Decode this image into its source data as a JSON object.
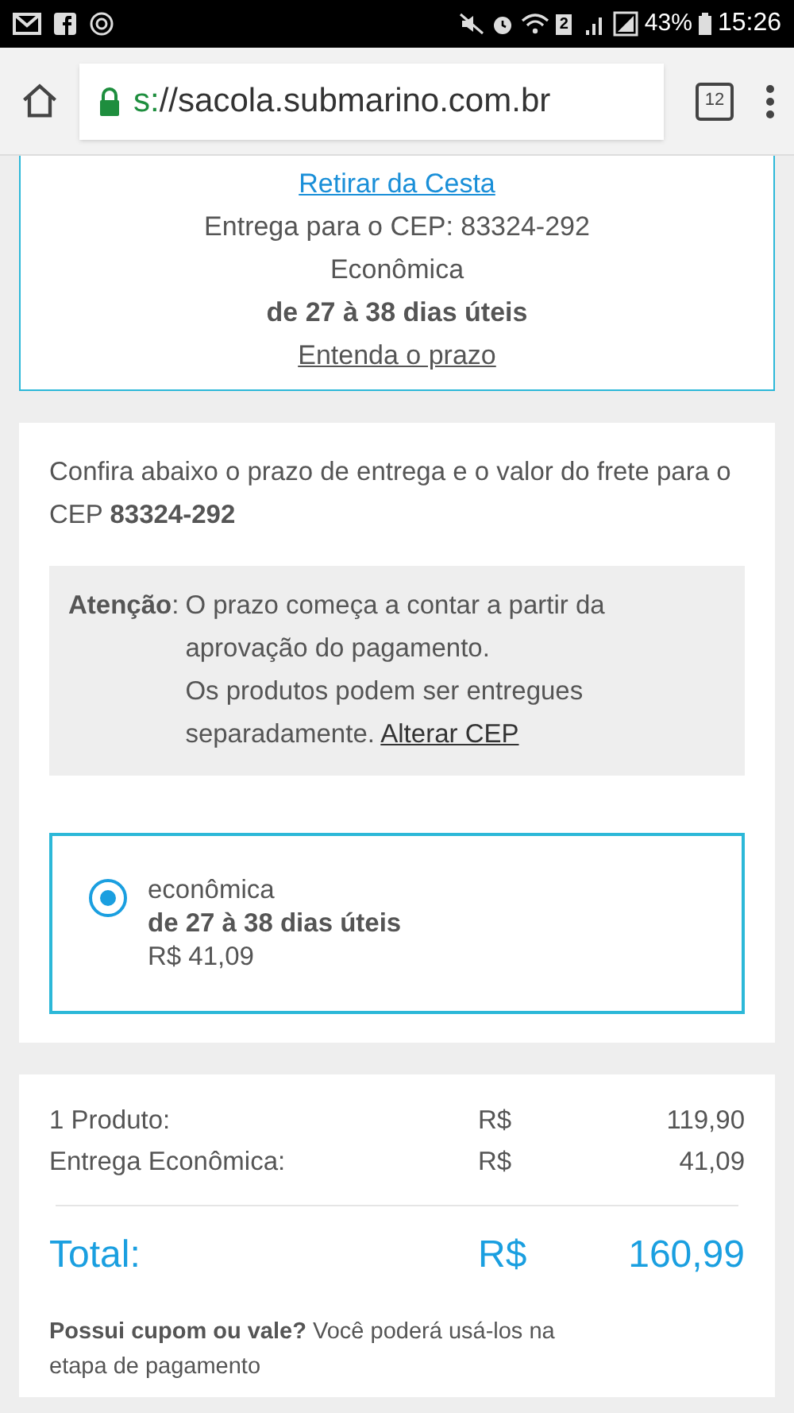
{
  "status_bar": {
    "sim_badge": "2",
    "battery": "43%",
    "time": "15:26"
  },
  "browser": {
    "url_scheme": "s:",
    "url_host": "//sacola.submarino.com.br",
    "tab_count": "12"
  },
  "pickup_card": {
    "link": "Retirar da Cesta",
    "cep_line": "Entrega para o CEP: 83324-292",
    "method": "Econômica",
    "days": "de 27 à 38 dias úteis",
    "info_link": "Entenda o prazo"
  },
  "shipping_card": {
    "intro": "Confira abaixo o prazo de entrega e o valor do frete para o CEP **83324-292**",
    "notice_label": "Atenção",
    "notice_colon": ":",
    "notice_text": "O prazo começa a contar a partir da aprovação do pagamento.",
    "notice_text2": "Os produtos podem ser entregues separadamente.",
    "notice_link": "Alterar CEP",
    "options": [
      {
        "name": "econômica",
        "days": "de 27 à 38 dias úteis",
        "price": "R$ 41,09",
        "selected": true
      }
    ]
  },
  "summary": {
    "rows": [
      {
        "label": "1 Produto:",
        "currency": "R$",
        "value": "119,90"
      },
      {
        "label": "Entrega Econômica:",
        "currency": "R$",
        "value": "41,09"
      }
    ],
    "total": {
      "label": "Total:",
      "currency": "R$",
      "value": "160,99"
    },
    "coupon_note": "**Possui cupom ou vale?** Você poderá usá-los na etapa de pagamento"
  }
}
